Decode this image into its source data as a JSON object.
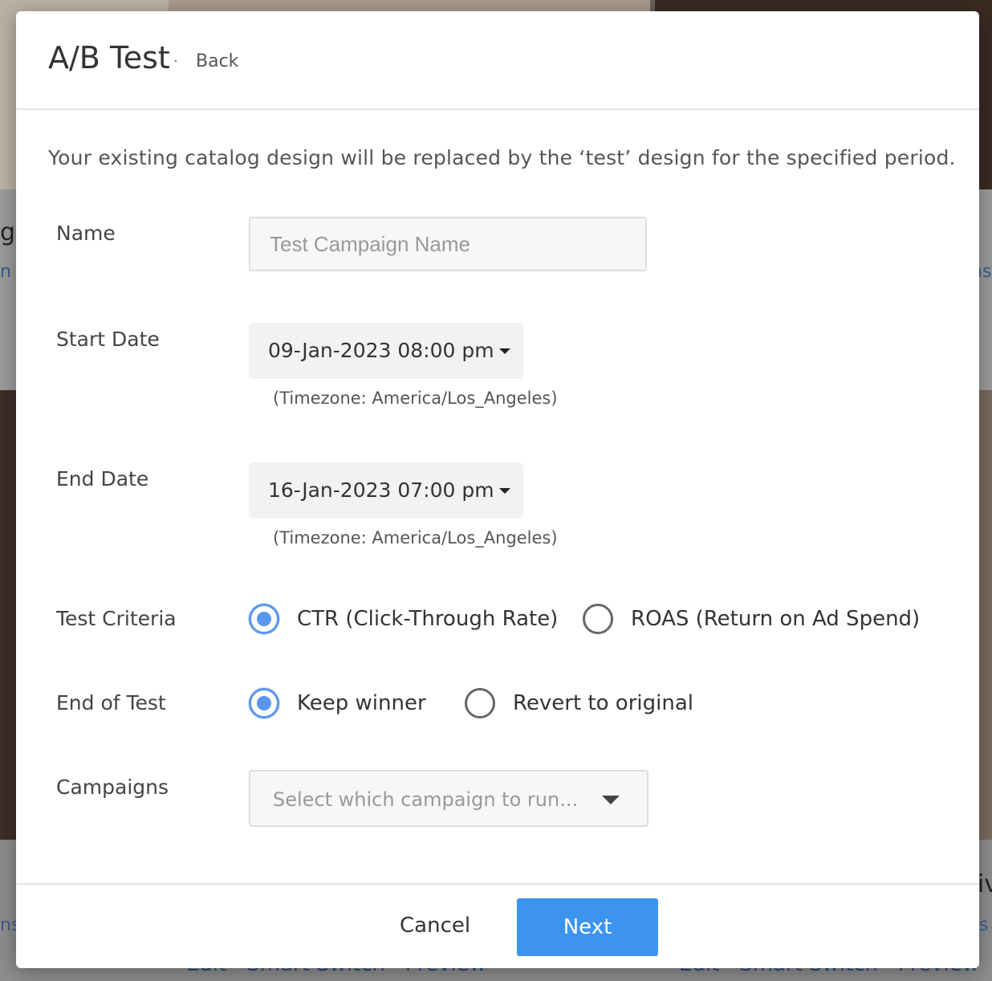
{
  "background": {
    "fragments": [
      "n",
      "ns",
      "ns",
      "ns",
      "Edit · Smart Switch · Preview",
      "Edit · Smart Switch · Preview",
      "gl",
      "iv"
    ]
  },
  "modal": {
    "title": "A/B Test",
    "separator": "·",
    "back_label": "Back",
    "intro": "Your existing catalog design will be replaced by the ‘test’ design for the specified period."
  },
  "form": {
    "name": {
      "label": "Name",
      "placeholder": "Test Campaign Name",
      "value": ""
    },
    "start_date": {
      "label": "Start Date",
      "value": "09-Jan-2023 08:00 pm",
      "timezone": "(Timezone: America/Los_Angeles)"
    },
    "end_date": {
      "label": "End Date",
      "value": "16-Jan-2023 07:00 pm",
      "timezone": "(Timezone: America/Los_Angeles)"
    },
    "test_criteria": {
      "label": "Test Criteria",
      "options": [
        "CTR (Click-Through Rate)",
        "ROAS (Return on Ad Spend)"
      ],
      "selected": "CTR (Click-Through Rate)"
    },
    "end_of_test": {
      "label": "End of Test",
      "options": [
        "Keep winner",
        "Revert to original"
      ],
      "selected": "Keep winner"
    },
    "campaigns": {
      "label": "Campaigns",
      "placeholder": "Select which campaign to run..."
    }
  },
  "footer": {
    "cancel_label": "Cancel",
    "next_label": "Next"
  },
  "colors": {
    "accent": "#3d94ee",
    "radio_checked": "#5b95ee"
  }
}
